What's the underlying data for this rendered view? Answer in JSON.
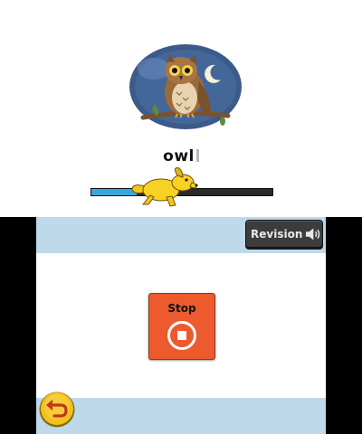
{
  "lesson": {
    "word": "owl",
    "picture": "owl-on-branch-night-illustration",
    "progress_fraction": 0.25
  },
  "toolbar": {
    "revision_label": "Revision",
    "revision_icon": "speaker-icon"
  },
  "controls": {
    "stop_label": "Stop",
    "stop_icon": "stop-icon",
    "back_icon": "back-arrow-icon"
  },
  "colors": {
    "band": "#bed9ea",
    "stop_button": "#ec5a2e",
    "progress_fill": "#3aa7dc",
    "progress_track": "#2b2b2b",
    "back_button": "#f3c21c"
  }
}
